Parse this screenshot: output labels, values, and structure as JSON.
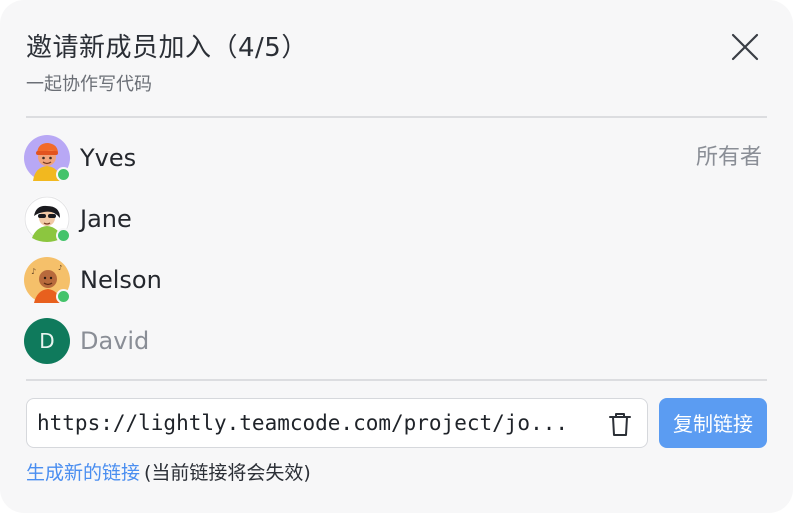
{
  "dialog": {
    "title": "邀请新成员加入（4/5）",
    "subtitle": "一起协作写代码",
    "close_icon": "close-icon"
  },
  "members": [
    {
      "name": "Yves",
      "role": "所有者",
      "avatar": "avatar-yves",
      "online": true,
      "pending": false,
      "avatar_color": "#b8a8f5"
    },
    {
      "name": "Jane",
      "role": "",
      "avatar": "avatar-jane",
      "online": true,
      "pending": false,
      "avatar_color": "#ffffff"
    },
    {
      "name": "Nelson",
      "role": "",
      "avatar": "avatar-nelson",
      "online": true,
      "pending": false,
      "avatar_color": "#f5c06a"
    },
    {
      "name": "David",
      "role": "",
      "avatar_letter": "D",
      "online": false,
      "pending": true,
      "avatar_color": "#0f7a5c"
    }
  ],
  "invite": {
    "link": "https://lightly.teamcode.com/project/jo...",
    "trash_icon": "trash-icon",
    "copy_label": "复制链接",
    "regenerate_label": "生成新的链接",
    "regenerate_note": "(当前链接将会失效)"
  },
  "colors": {
    "accent": "#5b9cf2",
    "link": "#4a8ef0",
    "online": "#44c36b",
    "background": "#f7f7f8"
  }
}
